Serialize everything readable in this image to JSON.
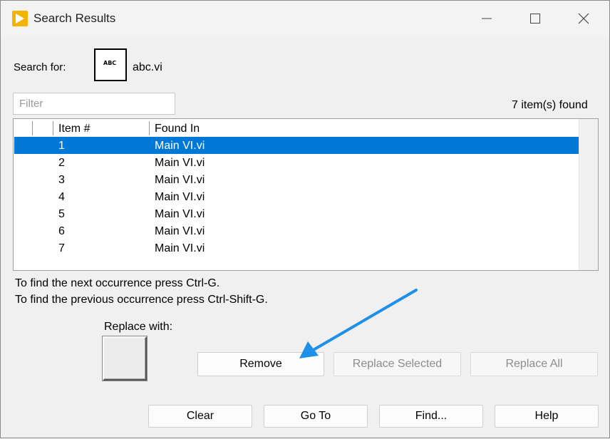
{
  "window": {
    "title": "Search Results",
    "icon": "labview-play-icon"
  },
  "search": {
    "label": "Search for:",
    "icon_text": "ABC",
    "term": "abc.vi"
  },
  "filter": {
    "placeholder": "Filter",
    "value": ""
  },
  "results": {
    "count_text": "7 item(s) found",
    "columns": [
      "Item #",
      "Found In"
    ],
    "rows": [
      {
        "num": "1",
        "found_in": "Main VI.vi",
        "selected": true
      },
      {
        "num": "2",
        "found_in": "Main VI.vi",
        "selected": false
      },
      {
        "num": "3",
        "found_in": "Main VI.vi",
        "selected": false
      },
      {
        "num": "4",
        "found_in": "Main VI.vi",
        "selected": false
      },
      {
        "num": "5",
        "found_in": "Main VI.vi",
        "selected": false
      },
      {
        "num": "6",
        "found_in": "Main VI.vi",
        "selected": false
      },
      {
        "num": "7",
        "found_in": "Main VI.vi",
        "selected": false
      }
    ]
  },
  "hints": {
    "next": "To find the next occurrence press Ctrl-G.",
    "previous": "To find the previous occurrence press Ctrl-Shift-G."
  },
  "replace": {
    "label": "Replace with:"
  },
  "buttons": {
    "remove": "Remove",
    "replace_selected": "Replace Selected",
    "replace_all": "Replace All",
    "clear": "Clear",
    "go_to": "Go To",
    "find": "Find...",
    "help": "Help"
  },
  "colors": {
    "selection": "#0078d7",
    "annotation_arrow": "#1e90e8",
    "app_icon": "#f5b400"
  }
}
